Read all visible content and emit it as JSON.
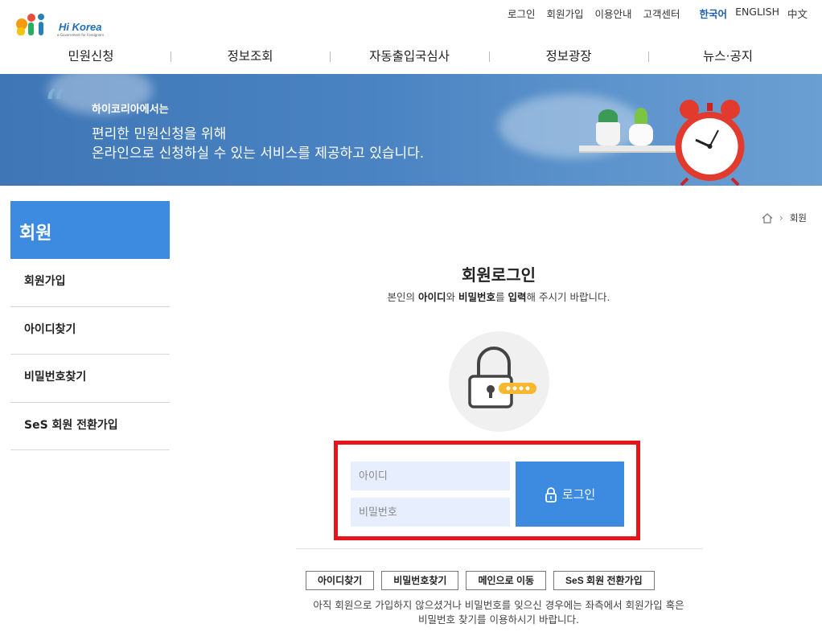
{
  "header": {
    "logo_text": "Hi Korea",
    "logo_subtitle": "e-Government for Foreigners",
    "util_links": [
      "로그인",
      "회원가입",
      "이용안내",
      "고객센터"
    ],
    "languages": [
      "한국어",
      "ENGLISH",
      "中文"
    ],
    "active_language": "한국어"
  },
  "gnb": [
    "민원신청",
    "정보조회",
    "자동출입국심사",
    "정보광장",
    "뉴스·공지"
  ],
  "banner": {
    "small": "하이코리아에서는",
    "line1": "편리한 민원신청을 위해",
    "line2": "온라인으로 신청하실 수 있는 서비스를 제공하고 있습니다."
  },
  "sidebar": {
    "title": "회원",
    "items": [
      "회원가입",
      "아이디찾기",
      "비밀번호찾기",
      "SeS 회원 전환가입"
    ]
  },
  "breadcrumb": {
    "current": "회원"
  },
  "main": {
    "title": "회원로그인",
    "desc_parts": [
      "본인의 ",
      "아이디",
      "와 ",
      "비밀번호",
      "를 ",
      "입력",
      "해 주시기 바랍니다."
    ],
    "id_placeholder": "아이디",
    "pw_placeholder": "비밀번호",
    "login_label": "로그인",
    "buttons": [
      "아이디찾기",
      "비밀번호찾기",
      "메인으로 이동",
      "SeS 회원 전환가입"
    ],
    "notice_line1": "아직 회원으로 가입하지 않으셨거나 비밀번호를 잊으신 경우에는 좌측에서 회원가입 혹은",
    "notice_line2": "비밀번호 찾기를 이용하시기 바랍니다."
  },
  "colors": {
    "accent": "#3c8be0",
    "highlight": "#e8141b",
    "input_bg": "#e7efff"
  }
}
